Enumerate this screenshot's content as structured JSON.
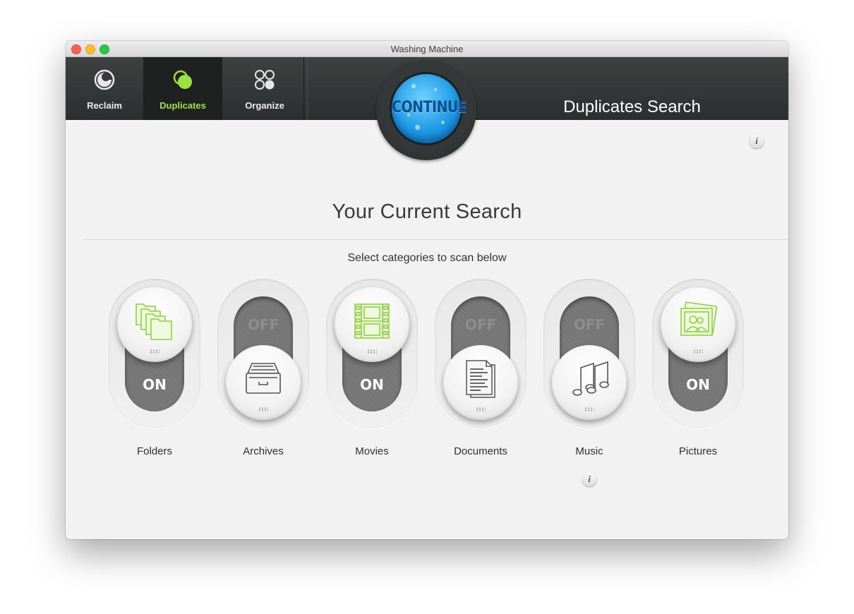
{
  "window": {
    "title": "Washing Machine"
  },
  "toolbar": {
    "tabs": [
      {
        "label": "Reclaim",
        "icon": "reclaim-icon",
        "active": false
      },
      {
        "label": "Duplicates",
        "icon": "duplicates-icon",
        "active": true
      },
      {
        "label": "Organize",
        "icon": "organize-icon",
        "active": false
      }
    ],
    "continue_label": "CONTINUE",
    "header_title": "Duplicates Search"
  },
  "main": {
    "title": "Your Current Search",
    "subtitle": "Select categories to scan below",
    "on_label": "ON",
    "off_label": "OFF",
    "categories": [
      {
        "label": "Folders",
        "state": "on",
        "icon": "folders-icon"
      },
      {
        "label": "Archives",
        "state": "off",
        "icon": "archive-icon"
      },
      {
        "label": "Movies",
        "state": "on",
        "icon": "film-icon"
      },
      {
        "label": "Documents",
        "state": "off",
        "icon": "document-icon"
      },
      {
        "label": "Music",
        "state": "off",
        "icon": "music-notes-icon"
      },
      {
        "label": "Pictures",
        "state": "on",
        "icon": "pictures-icon"
      }
    ]
  },
  "colors": {
    "accent_green": "#9be23d",
    "continue_blue": "#1f9be6",
    "toolbar_dark": "#2c2f2f"
  }
}
